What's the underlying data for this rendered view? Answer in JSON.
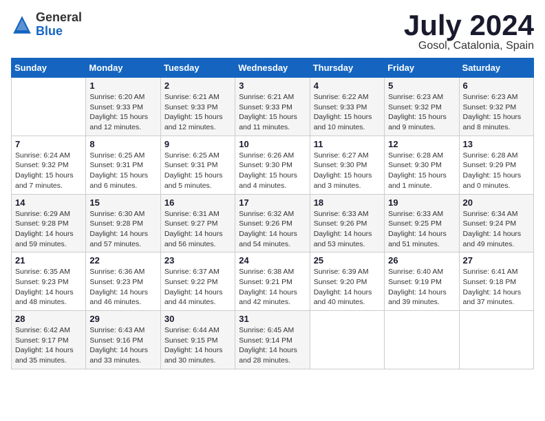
{
  "header": {
    "logo_general": "General",
    "logo_blue": "Blue",
    "month_title": "July 2024",
    "location": "Gosol, Catalonia, Spain"
  },
  "days_of_week": [
    "Sunday",
    "Monday",
    "Tuesday",
    "Wednesday",
    "Thursday",
    "Friday",
    "Saturday"
  ],
  "weeks": [
    [
      {
        "day": "",
        "info": ""
      },
      {
        "day": "1",
        "info": "Sunrise: 6:20 AM\nSunset: 9:33 PM\nDaylight: 15 hours\nand 12 minutes."
      },
      {
        "day": "2",
        "info": "Sunrise: 6:21 AM\nSunset: 9:33 PM\nDaylight: 15 hours\nand 12 minutes."
      },
      {
        "day": "3",
        "info": "Sunrise: 6:21 AM\nSunset: 9:33 PM\nDaylight: 15 hours\nand 11 minutes."
      },
      {
        "day": "4",
        "info": "Sunrise: 6:22 AM\nSunset: 9:33 PM\nDaylight: 15 hours\nand 10 minutes."
      },
      {
        "day": "5",
        "info": "Sunrise: 6:23 AM\nSunset: 9:32 PM\nDaylight: 15 hours\nand 9 minutes."
      },
      {
        "day": "6",
        "info": "Sunrise: 6:23 AM\nSunset: 9:32 PM\nDaylight: 15 hours\nand 8 minutes."
      }
    ],
    [
      {
        "day": "7",
        "info": "Sunrise: 6:24 AM\nSunset: 9:32 PM\nDaylight: 15 hours\nand 7 minutes."
      },
      {
        "day": "8",
        "info": "Sunrise: 6:25 AM\nSunset: 9:31 PM\nDaylight: 15 hours\nand 6 minutes."
      },
      {
        "day": "9",
        "info": "Sunrise: 6:25 AM\nSunset: 9:31 PM\nDaylight: 15 hours\nand 5 minutes."
      },
      {
        "day": "10",
        "info": "Sunrise: 6:26 AM\nSunset: 9:30 PM\nDaylight: 15 hours\nand 4 minutes."
      },
      {
        "day": "11",
        "info": "Sunrise: 6:27 AM\nSunset: 9:30 PM\nDaylight: 15 hours\nand 3 minutes."
      },
      {
        "day": "12",
        "info": "Sunrise: 6:28 AM\nSunset: 9:30 PM\nDaylight: 15 hours\nand 1 minute."
      },
      {
        "day": "13",
        "info": "Sunrise: 6:28 AM\nSunset: 9:29 PM\nDaylight: 15 hours\nand 0 minutes."
      }
    ],
    [
      {
        "day": "14",
        "info": "Sunrise: 6:29 AM\nSunset: 9:28 PM\nDaylight: 14 hours\nand 59 minutes."
      },
      {
        "day": "15",
        "info": "Sunrise: 6:30 AM\nSunset: 9:28 PM\nDaylight: 14 hours\nand 57 minutes."
      },
      {
        "day": "16",
        "info": "Sunrise: 6:31 AM\nSunset: 9:27 PM\nDaylight: 14 hours\nand 56 minutes."
      },
      {
        "day": "17",
        "info": "Sunrise: 6:32 AM\nSunset: 9:26 PM\nDaylight: 14 hours\nand 54 minutes."
      },
      {
        "day": "18",
        "info": "Sunrise: 6:33 AM\nSunset: 9:26 PM\nDaylight: 14 hours\nand 53 minutes."
      },
      {
        "day": "19",
        "info": "Sunrise: 6:33 AM\nSunset: 9:25 PM\nDaylight: 14 hours\nand 51 minutes."
      },
      {
        "day": "20",
        "info": "Sunrise: 6:34 AM\nSunset: 9:24 PM\nDaylight: 14 hours\nand 49 minutes."
      }
    ],
    [
      {
        "day": "21",
        "info": "Sunrise: 6:35 AM\nSunset: 9:23 PM\nDaylight: 14 hours\nand 48 minutes."
      },
      {
        "day": "22",
        "info": "Sunrise: 6:36 AM\nSunset: 9:23 PM\nDaylight: 14 hours\nand 46 minutes."
      },
      {
        "day": "23",
        "info": "Sunrise: 6:37 AM\nSunset: 9:22 PM\nDaylight: 14 hours\nand 44 minutes."
      },
      {
        "day": "24",
        "info": "Sunrise: 6:38 AM\nSunset: 9:21 PM\nDaylight: 14 hours\nand 42 minutes."
      },
      {
        "day": "25",
        "info": "Sunrise: 6:39 AM\nSunset: 9:20 PM\nDaylight: 14 hours\nand 40 minutes."
      },
      {
        "day": "26",
        "info": "Sunrise: 6:40 AM\nSunset: 9:19 PM\nDaylight: 14 hours\nand 39 minutes."
      },
      {
        "day": "27",
        "info": "Sunrise: 6:41 AM\nSunset: 9:18 PM\nDaylight: 14 hours\nand 37 minutes."
      }
    ],
    [
      {
        "day": "28",
        "info": "Sunrise: 6:42 AM\nSunset: 9:17 PM\nDaylight: 14 hours\nand 35 minutes."
      },
      {
        "day": "29",
        "info": "Sunrise: 6:43 AM\nSunset: 9:16 PM\nDaylight: 14 hours\nand 33 minutes."
      },
      {
        "day": "30",
        "info": "Sunrise: 6:44 AM\nSunset: 9:15 PM\nDaylight: 14 hours\nand 30 minutes."
      },
      {
        "day": "31",
        "info": "Sunrise: 6:45 AM\nSunset: 9:14 PM\nDaylight: 14 hours\nand 28 minutes."
      },
      {
        "day": "",
        "info": ""
      },
      {
        "day": "",
        "info": ""
      },
      {
        "day": "",
        "info": ""
      }
    ]
  ]
}
